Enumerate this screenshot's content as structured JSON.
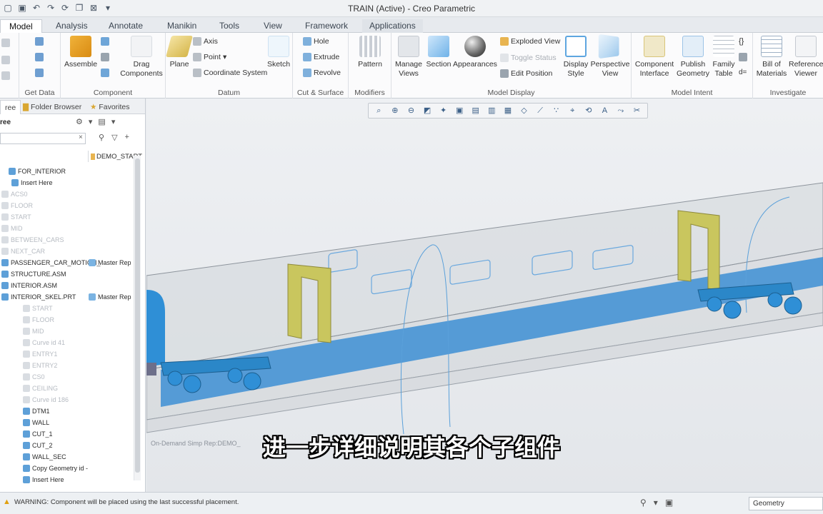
{
  "window": {
    "title": "TRAIN (Active) - Creo Parametric"
  },
  "quick_access": [
    "new-icon",
    "save-icon",
    "undo-icon",
    "redo-icon",
    "regenerate-icon",
    "window-icon",
    "close-window-icon",
    "customize-icon"
  ],
  "tabs": [
    "Model",
    "Analysis",
    "Annotate",
    "Manikin",
    "Tools",
    "View",
    "Framework",
    "Applications"
  ],
  "ribbon": {
    "groups": {
      "get_data": "Get Data",
      "component": "Component",
      "datum": "Datum",
      "cut_surface": "Cut & Surface",
      "modifiers": "Modifiers",
      "model_display": "Model Display",
      "model_intent": "Model Intent",
      "investigate": "Investigate"
    },
    "assemble": "Assemble",
    "drag_components": [
      "Drag",
      "Components"
    ],
    "plane": "Plane",
    "axis": "Axis",
    "point": "Point",
    "coordinate_system": "Coordinate System",
    "sketch": "Sketch",
    "hole": "Hole",
    "extrude": "Extrude",
    "revolve": "Revolve",
    "pattern": "Pattern",
    "manage_views": [
      "Manage",
      "Views"
    ],
    "section": "Section",
    "appearances": "Appearances",
    "exploded_view": "Exploded View",
    "toggle_status": "Toggle Status",
    "edit_position": "Edit Position",
    "display_style": [
      "Display",
      "Style"
    ],
    "perspective_view": [
      "Perspective",
      "View"
    ],
    "component_interface": [
      "Component",
      "Interface"
    ],
    "publish_geometry": [
      "Publish",
      "Geometry"
    ],
    "family_table": [
      "Family",
      "Table"
    ],
    "bill_of_materials": [
      "Bill of",
      "Materials"
    ],
    "reference_viewer": [
      "Reference",
      "Viewer"
    ]
  },
  "panel": {
    "tabs": [
      "ree",
      "Folder Browser",
      "Favorites"
    ],
    "tree_label": "ree",
    "column_header": "DEMO_START",
    "items": [
      {
        "label": "FOR_INTERIOR",
        "dim": false,
        "indent": 12,
        "col2": ""
      },
      {
        "label": "Insert Here",
        "dim": false,
        "indent": 16,
        "col2": ""
      },
      {
        "label": "ACS0",
        "dim": true,
        "indent": 2,
        "col2": ""
      },
      {
        "label": "FLOOR",
        "dim": true,
        "indent": 2,
        "col2": ""
      },
      {
        "label": "START",
        "dim": true,
        "indent": 2,
        "col2": ""
      },
      {
        "label": "MID",
        "dim": true,
        "indent": 2,
        "col2": ""
      },
      {
        "label": "BETWEEN_CARS",
        "dim": true,
        "indent": 2,
        "col2": ""
      },
      {
        "label": "NEXT_CAR",
        "dim": true,
        "indent": 2,
        "col2": ""
      },
      {
        "label": "PASSENGER_CAR_MOTION_",
        "dim": false,
        "indent": 2,
        "col2": "Master Rep"
      },
      {
        "label": "STRUCTURE.ASM",
        "dim": false,
        "indent": 2,
        "col2": ""
      },
      {
        "label": "INTERIOR.ASM",
        "dim": false,
        "indent": 2,
        "col2": ""
      },
      {
        "label": "INTERIOR_SKEL.PRT",
        "dim": false,
        "indent": 2,
        "col2": "Master Rep"
      },
      {
        "label": "START",
        "dim": true,
        "indent": 32,
        "col2": ""
      },
      {
        "label": "FLOOR",
        "dim": true,
        "indent": 32,
        "col2": ""
      },
      {
        "label": "MID",
        "dim": true,
        "indent": 32,
        "col2": ""
      },
      {
        "label": "Curve id 41",
        "dim": true,
        "indent": 32,
        "col2": ""
      },
      {
        "label": "ENTRY1",
        "dim": true,
        "indent": 32,
        "col2": ""
      },
      {
        "label": "ENTRY2",
        "dim": true,
        "indent": 32,
        "col2": ""
      },
      {
        "label": "CS0",
        "dim": true,
        "indent": 32,
        "col2": ""
      },
      {
        "label": "CEILING",
        "dim": true,
        "indent": 32,
        "col2": ""
      },
      {
        "label": "Curve id 186",
        "dim": true,
        "indent": 32,
        "col2": ""
      },
      {
        "label": "DTM1",
        "dim": false,
        "indent": 32,
        "col2": ""
      },
      {
        "label": "WALL",
        "dim": false,
        "indent": 32,
        "col2": ""
      },
      {
        "label": "CUT_1",
        "dim": false,
        "indent": 32,
        "col2": ""
      },
      {
        "label": "CUT_2",
        "dim": false,
        "indent": 32,
        "col2": ""
      },
      {
        "label": "WALL_SEC",
        "dim": false,
        "indent": 32,
        "col2": ""
      },
      {
        "label": "Copy Geometry id -",
        "dim": false,
        "indent": 32,
        "col2": ""
      },
      {
        "label": "Insert Here",
        "dim": false,
        "indent": 32,
        "col2": ""
      }
    ]
  },
  "viewport": {
    "simp_rep": "On-Demand Simp Rep:DEMO_",
    "toolbar_icons": [
      "refit-icon",
      "zoom-in-icon",
      "zoom-out-icon",
      "repaint-icon",
      "spin-center-icon",
      "display-style-icon",
      "saved-views-icon",
      "view-manager-icon",
      "annotation-display-icon",
      "datum-plane-display-icon",
      "datum-axis-display-icon",
      "point-display-icon",
      "csys-display-icon",
      "spin-icon",
      "annotation-icon",
      "annotation-orient-icon",
      "clip-icon"
    ]
  },
  "subtitle": "进一步详细说明其各个子组件",
  "status": {
    "message": "WARNING: Component will be placed using the last successful placement.",
    "filter": "Geometry"
  },
  "colors": {
    "accent_blue": "#2f8fd6",
    "yellow_frame": "#c9c65e",
    "shell_gray": "#bfc3c8"
  }
}
